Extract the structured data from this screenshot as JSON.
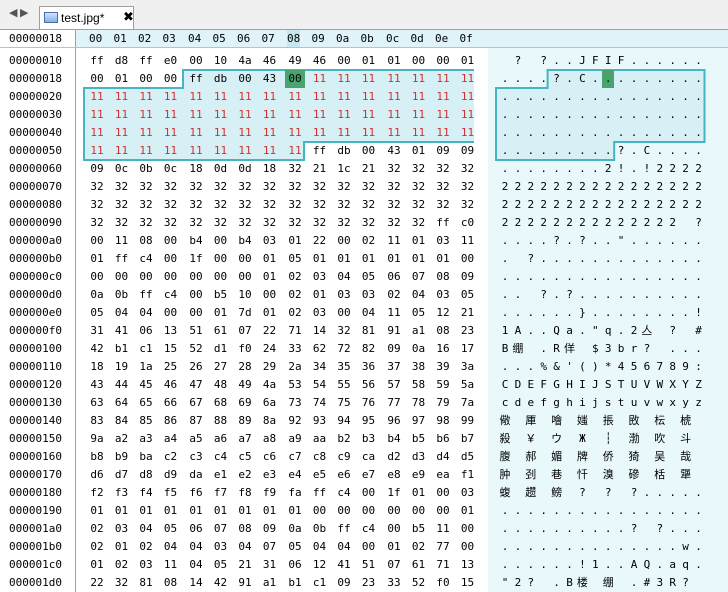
{
  "tabbar": {
    "back_glyph": "◀",
    "forward_glyph": "▶",
    "tab_label": "test.jpg*",
    "close_glyph": "✖",
    "file_icon": "image-file-icon"
  },
  "header": {
    "address": "00000018",
    "columns": [
      "00",
      "01",
      "02",
      "03",
      "04",
      "05",
      "06",
      "07",
      "08",
      "09",
      "0a",
      "0b",
      "0c",
      "0d",
      "0e",
      "0f"
    ]
  },
  "colors": {
    "selection_fill": "#d6f0f6",
    "selection_border": "#46b5c2",
    "cursor": "#4aa36e",
    "selected_bytes": "#d23030"
  },
  "rows": [
    {
      "offset": "00000010",
      "hex": [
        "ff",
        "d8",
        "ff",
        "e0",
        "00",
        "10",
        "4a",
        "46",
        "49",
        "46",
        "00",
        "01",
        "01",
        "00",
        "00",
        "01"
      ],
      "ascii": [
        " ",
        "?",
        " ",
        "?",
        ".",
        ".",
        "J",
        "F",
        "I",
        "F",
        ".",
        ".",
        ".",
        ".",
        ".",
        "."
      ]
    },
    {
      "offset": "00000018",
      "hex": [
        "00",
        "01",
        "00",
        "00",
        "ff",
        "db",
        "00",
        "43",
        "00",
        "11",
        "11",
        "11",
        "11",
        "11",
        "11",
        "11"
      ],
      "ascii": [
        ".",
        ".",
        ".",
        ".",
        "?",
        ".",
        "C",
        ".",
        ".",
        ".",
        ".",
        ".",
        ".",
        ".",
        ".",
        "."
      ]
    },
    {
      "offset": "00000020",
      "hex": [
        "11",
        "11",
        "11",
        "11",
        "11",
        "11",
        "11",
        "11",
        "11",
        "11",
        "11",
        "11",
        "11",
        "11",
        "11",
        "11"
      ],
      "ascii": [
        ".",
        ".",
        ".",
        ".",
        ".",
        ".",
        ".",
        ".",
        ".",
        ".",
        ".",
        ".",
        ".",
        ".",
        ".",
        "."
      ]
    },
    {
      "offset": "00000030",
      "hex": [
        "11",
        "11",
        "11",
        "11",
        "11",
        "11",
        "11",
        "11",
        "11",
        "11",
        "11",
        "11",
        "11",
        "11",
        "11",
        "11"
      ],
      "ascii": [
        ".",
        ".",
        ".",
        ".",
        ".",
        ".",
        ".",
        ".",
        ".",
        ".",
        ".",
        ".",
        ".",
        ".",
        ".",
        "."
      ]
    },
    {
      "offset": "00000040",
      "hex": [
        "11",
        "11",
        "11",
        "11",
        "11",
        "11",
        "11",
        "11",
        "11",
        "11",
        "11",
        "11",
        "11",
        "11",
        "11",
        "11"
      ],
      "ascii": [
        ".",
        ".",
        ".",
        ".",
        ".",
        ".",
        ".",
        ".",
        ".",
        ".",
        ".",
        ".",
        ".",
        ".",
        ".",
        "."
      ]
    },
    {
      "offset": "00000050",
      "hex": [
        "11",
        "11",
        "11",
        "11",
        "11",
        "11",
        "11",
        "11",
        "11",
        "ff",
        "db",
        "00",
        "43",
        "01",
        "09",
        "09"
      ],
      "ascii": [
        ".",
        ".",
        ".",
        ".",
        ".",
        ".",
        ".",
        ".",
        ".",
        "?",
        ".",
        "C",
        ".",
        ".",
        ".",
        "."
      ]
    },
    {
      "offset": "00000060",
      "hex": [
        "09",
        "0c",
        "0b",
        "0c",
        "18",
        "0d",
        "0d",
        "18",
        "32",
        "21",
        "1c",
        "21",
        "32",
        "32",
        "32",
        "32"
      ],
      "ascii": [
        ".",
        ".",
        ".",
        ".",
        ".",
        ".",
        ".",
        ".",
        "2",
        "!",
        ".",
        "!",
        "2",
        "2",
        "2",
        "2"
      ]
    },
    {
      "offset": "00000070",
      "hex": [
        "32",
        "32",
        "32",
        "32",
        "32",
        "32",
        "32",
        "32",
        "32",
        "32",
        "32",
        "32",
        "32",
        "32",
        "32",
        "32"
      ],
      "ascii": [
        "2",
        "2",
        "2",
        "2",
        "2",
        "2",
        "2",
        "2",
        "2",
        "2",
        "2",
        "2",
        "2",
        "2",
        "2",
        "2"
      ]
    },
    {
      "offset": "00000080",
      "hex": [
        "32",
        "32",
        "32",
        "32",
        "32",
        "32",
        "32",
        "32",
        "32",
        "32",
        "32",
        "32",
        "32",
        "32",
        "32",
        "32"
      ],
      "ascii": [
        "2",
        "2",
        "2",
        "2",
        "2",
        "2",
        "2",
        "2",
        "2",
        "2",
        "2",
        "2",
        "2",
        "2",
        "2",
        "2"
      ]
    },
    {
      "offset": "00000090",
      "hex": [
        "32",
        "32",
        "32",
        "32",
        "32",
        "32",
        "32",
        "32",
        "32",
        "32",
        "32",
        "32",
        "32",
        "32",
        "ff",
        "c0"
      ],
      "ascii": [
        "2",
        "2",
        "2",
        "2",
        "2",
        "2",
        "2",
        "2",
        "2",
        "2",
        "2",
        "2",
        "2",
        "2",
        " ",
        "?"
      ]
    },
    {
      "offset": "000000a0",
      "hex": [
        "00",
        "11",
        "08",
        "00",
        "b4",
        "00",
        "b4",
        "03",
        "01",
        "22",
        "00",
        "02",
        "11",
        "01",
        "03",
        "11"
      ],
      "ascii": [
        ".",
        ".",
        ".",
        ".",
        "?",
        ".",
        "?",
        ".",
        ".",
        "\"",
        ".",
        ".",
        ".",
        ".",
        ".",
        "."
      ]
    },
    {
      "offset": "000000b0",
      "hex": [
        "01",
        "ff",
        "c4",
        "00",
        "1f",
        "00",
        "00",
        "01",
        "05",
        "01",
        "01",
        "01",
        "01",
        "01",
        "01",
        "00"
      ],
      "ascii": [
        ".",
        " ",
        "?",
        ".",
        ".",
        ".",
        ".",
        ".",
        ".",
        ".",
        ".",
        ".",
        ".",
        ".",
        ".",
        "."
      ]
    },
    {
      "offset": "000000c0",
      "hex": [
        "00",
        "00",
        "00",
        "00",
        "00",
        "00",
        "00",
        "01",
        "02",
        "03",
        "04",
        "05",
        "06",
        "07",
        "08",
        "09"
      ],
      "ascii": [
        ".",
        ".",
        ".",
        ".",
        ".",
        ".",
        ".",
        ".",
        ".",
        ".",
        ".",
        ".",
        ".",
        ".",
        ".",
        "."
      ]
    },
    {
      "offset": "000000d0",
      "hex": [
        "0a",
        "0b",
        "ff",
        "c4",
        "00",
        "b5",
        "10",
        "00",
        "02",
        "01",
        "03",
        "03",
        "02",
        "04",
        "03",
        "05"
      ],
      "ascii": [
        ".",
        ".",
        " ",
        "?",
        ".",
        "?",
        ".",
        ".",
        ".",
        ".",
        ".",
        ".",
        ".",
        ".",
        ".",
        "."
      ]
    },
    {
      "offset": "000000e0",
      "hex": [
        "05",
        "04",
        "04",
        "00",
        "00",
        "01",
        "7d",
        "01",
        "02",
        "03",
        "00",
        "04",
        "11",
        "05",
        "12",
        "21"
      ],
      "ascii": [
        ".",
        ".",
        ".",
        ".",
        ".",
        ".",
        "}",
        ".",
        ".",
        ".",
        ".",
        ".",
        ".",
        ".",
        ".",
        "!"
      ]
    },
    {
      "offset": "000000f0",
      "hex": [
        "31",
        "41",
        "06",
        "13",
        "51",
        "61",
        "07",
        "22",
        "71",
        "14",
        "32",
        "81",
        "91",
        "a1",
        "08",
        "23"
      ],
      "ascii": [
        "1",
        "A",
        ".",
        ".",
        "Q",
        "a",
        ".",
        "\"",
        "q",
        ".",
        "2",
        "亼",
        " ",
        "?",
        " ",
        "#"
      ]
    },
    {
      "offset": "00000100",
      "hex": [
        "42",
        "b1",
        "c1",
        "15",
        "52",
        "d1",
        "f0",
        "24",
        "33",
        "62",
        "72",
        "82",
        "09",
        "0a",
        "16",
        "17"
      ],
      "ascii": [
        "B",
        "绷",
        " ",
        ".",
        "R",
        "佯",
        " ",
        "$",
        "3",
        "b",
        "r",
        "?",
        " ",
        ".",
        ".",
        "."
      ]
    },
    {
      "offset": "00000110",
      "hex": [
        "18",
        "19",
        "1a",
        "25",
        "26",
        "27",
        "28",
        "29",
        "2a",
        "34",
        "35",
        "36",
        "37",
        "38",
        "39",
        "3a"
      ],
      "ascii": [
        ".",
        ".",
        ".",
        "%",
        "&",
        "'",
        "(",
        ")",
        "*",
        "4",
        "5",
        "6",
        "7",
        "8",
        "9",
        ":"
      ]
    },
    {
      "offset": "00000120",
      "hex": [
        "43",
        "44",
        "45",
        "46",
        "47",
        "48",
        "49",
        "4a",
        "53",
        "54",
        "55",
        "56",
        "57",
        "58",
        "59",
        "5a"
      ],
      "ascii": [
        "C",
        "D",
        "E",
        "F",
        "G",
        "H",
        "I",
        "J",
        "S",
        "T",
        "U",
        "V",
        "W",
        "X",
        "Y",
        "Z"
      ]
    },
    {
      "offset": "00000130",
      "hex": [
        "63",
        "64",
        "65",
        "66",
        "67",
        "68",
        "69",
        "6a",
        "73",
        "74",
        "75",
        "76",
        "77",
        "78",
        "79",
        "7a"
      ],
      "ascii": [
        "c",
        "d",
        "e",
        "f",
        "g",
        "h",
        "i",
        "j",
        "s",
        "t",
        "u",
        "v",
        "w",
        "x",
        "y",
        "z"
      ]
    },
    {
      "offset": "00000140",
      "hex": [
        "83",
        "84",
        "85",
        "86",
        "87",
        "88",
        "89",
        "8a",
        "92",
        "93",
        "94",
        "95",
        "96",
        "97",
        "98",
        "99"
      ],
      "ascii": [
        "儆",
        " ",
        "厙",
        " ",
        "噲",
        " ",
        "媸",
        " ",
        "掁",
        " ",
        "敃",
        " ",
        "枟",
        " ",
        "椃",
        " "
      ]
    },
    {
      "offset": "00000150",
      "hex": [
        "9a",
        "a2",
        "a3",
        "a4",
        "a5",
        "a6",
        "a7",
        "a8",
        "a9",
        "aa",
        "b2",
        "b3",
        "b4",
        "b5",
        "b6",
        "b7"
      ],
      "ascii": [
        "殺",
        " ",
        "￥",
        " ",
        "ウ",
        " ",
        "Ж",
        " ",
        "┆",
        " ",
        "渤",
        " ",
        "吹",
        " ",
        "斗",
        " "
      ]
    },
    {
      "offset": "00000160",
      "hex": [
        "b8",
        "b9",
        "ba",
        "c2",
        "c3",
        "c4",
        "c5",
        "c6",
        "c7",
        "c8",
        "c9",
        "ca",
        "d2",
        "d3",
        "d4",
        "d5"
      ],
      "ascii": [
        "腹",
        " ",
        "郝",
        " ",
        "媚",
        " ",
        "牌",
        " ",
        "侨",
        " ",
        "猗",
        " ",
        "吴",
        " ",
        "哉",
        " "
      ]
    },
    {
      "offset": "00000170",
      "hex": [
        "d6",
        "d7",
        "d8",
        "d9",
        "da",
        "e1",
        "e2",
        "e3",
        "e4",
        "e5",
        "e6",
        "e7",
        "e8",
        "e9",
        "ea",
        "f1"
      ],
      "ascii": [
        "肿",
        " ",
        "刭",
        " ",
        "巷",
        " ",
        "忏",
        " ",
        "溴",
        " ",
        "磣",
        " ",
        "栝",
        " ",
        "犟",
        " "
      ]
    },
    {
      "offset": "00000180",
      "hex": [
        "f2",
        "f3",
        "f4",
        "f5",
        "f6",
        "f7",
        "f8",
        "f9",
        "fa",
        "ff",
        "c4",
        "00",
        "1f",
        "01",
        "00",
        "03"
      ],
      "ascii": [
        "蝮",
        " ",
        "趱",
        " ",
        "鳑",
        " ",
        "?",
        " ",
        "?",
        " ",
        "?",
        ".",
        ".",
        ".",
        ".",
        "."
      ]
    },
    {
      "offset": "00000190",
      "hex": [
        "01",
        "01",
        "01",
        "01",
        "01",
        "01",
        "01",
        "01",
        "01",
        "00",
        "00",
        "00",
        "00",
        "00",
        "00",
        "01"
      ],
      "ascii": [
        ".",
        ".",
        ".",
        ".",
        ".",
        ".",
        ".",
        ".",
        ".",
        ".",
        ".",
        ".",
        ".",
        ".",
        ".",
        "."
      ]
    },
    {
      "offset": "000001a0",
      "hex": [
        "02",
        "03",
        "04",
        "05",
        "06",
        "07",
        "08",
        "09",
        "0a",
        "0b",
        "ff",
        "c4",
        "00",
        "b5",
        "11",
        "00"
      ],
      "ascii": [
        ".",
        ".",
        ".",
        ".",
        ".",
        ".",
        ".",
        ".",
        ".",
        ".",
        "?",
        " ",
        "?",
        ".",
        ".",
        "."
      ]
    },
    {
      "offset": "000001b0",
      "hex": [
        "02",
        "01",
        "02",
        "04",
        "04",
        "03",
        "04",
        "07",
        "05",
        "04",
        "04",
        "00",
        "01",
        "02",
        "77",
        "00"
      ],
      "ascii": [
        ".",
        ".",
        ".",
        ".",
        ".",
        ".",
        ".",
        ".",
        ".",
        ".",
        ".",
        ".",
        ".",
        ".",
        "w",
        "."
      ]
    },
    {
      "offset": "000001c0",
      "hex": [
        "01",
        "02",
        "03",
        "11",
        "04",
        "05",
        "21",
        "31",
        "06",
        "12",
        "41",
        "51",
        "07",
        "61",
        "71",
        "13"
      ],
      "ascii": [
        ".",
        ".",
        ".",
        ".",
        ".",
        ".",
        "!",
        "1",
        ".",
        ".",
        "A",
        "Q",
        ".",
        "a",
        "q",
        "."
      ]
    },
    {
      "offset": "000001d0",
      "hex": [
        "22",
        "32",
        "81",
        "08",
        "14",
        "42",
        "91",
        "a1",
        "b1",
        "c1",
        "09",
        "23",
        "33",
        "52",
        "f0",
        "15"
      ],
      "ascii": [
        "\"",
        "2",
        "?",
        " ",
        ".",
        "B",
        "楼",
        " ",
        "绷",
        " ",
        ".",
        "#",
        "3",
        "R",
        "?",
        " "
      ]
    }
  ]
}
